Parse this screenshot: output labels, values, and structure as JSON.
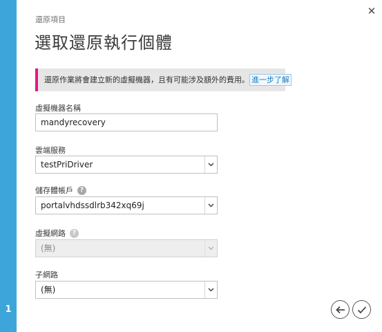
{
  "wizard": {
    "step_number": "1"
  },
  "header": {
    "breadcrumb": "還原項目",
    "title": "選取還原執行個體"
  },
  "notice": {
    "text": "還原作業將會建立新的虛擬機器，且有可能涉及額外的費用。",
    "link": "進一步了解",
    "accent_color": "#e0178a"
  },
  "fields": {
    "vm_name": {
      "label": "虛擬機器名稱",
      "value": "mandyrecovery"
    },
    "cloud_service": {
      "label": "雲端服務",
      "value": "testPriDriver"
    },
    "storage_account": {
      "label": "儲存體帳戶",
      "value": "portalvhdssdlrb342xq69j",
      "help_icon": "?"
    },
    "virtual_network": {
      "label": "虛擬網路",
      "value": "(無)",
      "help_icon": "?",
      "disabled": true
    },
    "subnet": {
      "label": "子網路",
      "value": "(無)"
    }
  },
  "icons": {
    "close": "close-icon",
    "back": "arrow-left-icon",
    "confirm": "checkmark-icon"
  },
  "colors": {
    "step_rail": "#3da5d9",
    "link": "#1b7ec2"
  }
}
